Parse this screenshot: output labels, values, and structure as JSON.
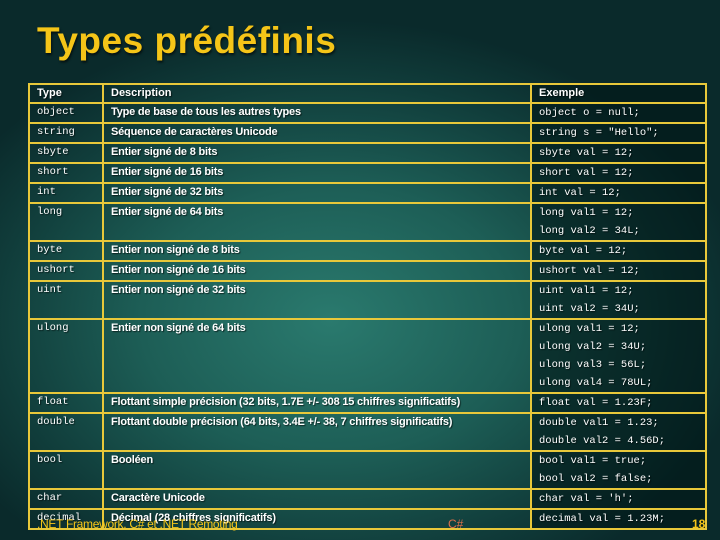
{
  "slide": {
    "title": "Types prédéfinis",
    "footer_left": ".NET Framework, C# et .NET Remoting",
    "footer_center": "C#",
    "page_number": "18"
  },
  "table": {
    "headers": [
      "Type",
      "Description",
      "Exemple"
    ],
    "rows": [
      {
        "type": "object",
        "description": "Type de base de tous les autres types",
        "examples": [
          "object o = null;"
        ]
      },
      {
        "type": "string",
        "description": "Séquence de caractères Unicode",
        "examples": [
          "string s = \"Hello\";"
        ]
      },
      {
        "type": "sbyte",
        "description": "Entier signé de 8 bits",
        "examples": [
          "sbyte val = 12;"
        ]
      },
      {
        "type": "short",
        "description": "Entier signé de 16 bits",
        "examples": [
          "short val = 12;"
        ]
      },
      {
        "type": "int",
        "description": "Entier signé de 32 bits",
        "examples": [
          "int val = 12;"
        ]
      },
      {
        "type": "long",
        "description": "Entier signé de 64 bits",
        "examples": [
          "long val1 = 12;",
          "long val2 = 34L;"
        ]
      },
      {
        "type": "byte",
        "description": "Entier non signé de 8 bits",
        "examples": [
          "byte val = 12;"
        ]
      },
      {
        "type": "ushort",
        "description": "Entier non signé de 16 bits",
        "examples": [
          "ushort val = 12;"
        ]
      },
      {
        "type": "uint",
        "description": "Entier non signé de 32 bits",
        "examples": [
          "uint val1 = 12;",
          "uint val2 = 34U;"
        ]
      },
      {
        "type": "ulong",
        "description": "Entier non signé de 64 bits",
        "examples": [
          "ulong val1 = 12;",
          "ulong val2 = 34U;",
          "ulong val3 = 56L;",
          "ulong val4 = 78UL;"
        ]
      },
      {
        "type": "float",
        "description": "Flottant simple précision (32 bits, 1.7E +/- 308 15 chiffres significatifs)",
        "examples": [
          "float val = 1.23F;"
        ]
      },
      {
        "type": "double",
        "description": "Flottant double précision (64 bits, 3.4E +/- 38, 7 chiffres significatifs)",
        "examples": [
          "double val1 = 1.23;",
          "double val2 = 4.56D;"
        ]
      },
      {
        "type": "bool",
        "description": "Booléen",
        "examples": [
          "bool val1 = true;",
          "bool val2 = false;"
        ]
      },
      {
        "type": "char",
        "description": "Caractère Unicode",
        "examples": [
          "char val = 'h';"
        ]
      },
      {
        "type": "decimal",
        "description": "Décimal (28 chiffres significatifs)",
        "examples": [
          "decimal val = 1.23M;"
        ]
      }
    ]
  },
  "colors": {
    "title": "#f5c518",
    "grid": "#e8c83a",
    "footer_center": "#e0704a"
  }
}
